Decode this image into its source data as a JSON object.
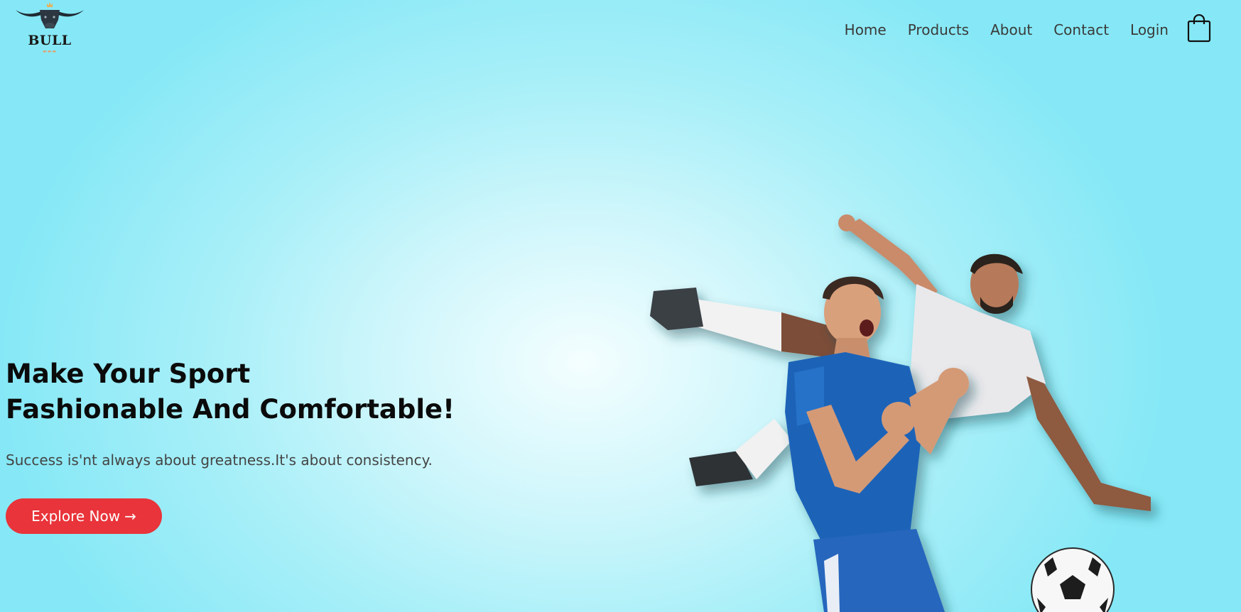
{
  "brand": {
    "name": "BULL",
    "logo_icon": "bull-horns-icon"
  },
  "nav": {
    "items": [
      {
        "label": "Home"
      },
      {
        "label": "Products"
      },
      {
        "label": "About"
      },
      {
        "label": "Contact"
      },
      {
        "label": "Login"
      }
    ],
    "cart_icon": "shopping-bag-icon"
  },
  "hero": {
    "title_line1": "Make Your Sport",
    "title_line2": "Fashionable And Comfortable!",
    "subtitle": "Success is'nt always about greatness.It's about consistency.",
    "cta_label": "Explore Now",
    "cta_arrow": "→",
    "image_subject": "two soccer players celebrating with ball"
  },
  "colors": {
    "background": "#86e8f6",
    "accent": "#e8343a",
    "title": "#0b0b0b",
    "text": "#3a3a3a"
  }
}
